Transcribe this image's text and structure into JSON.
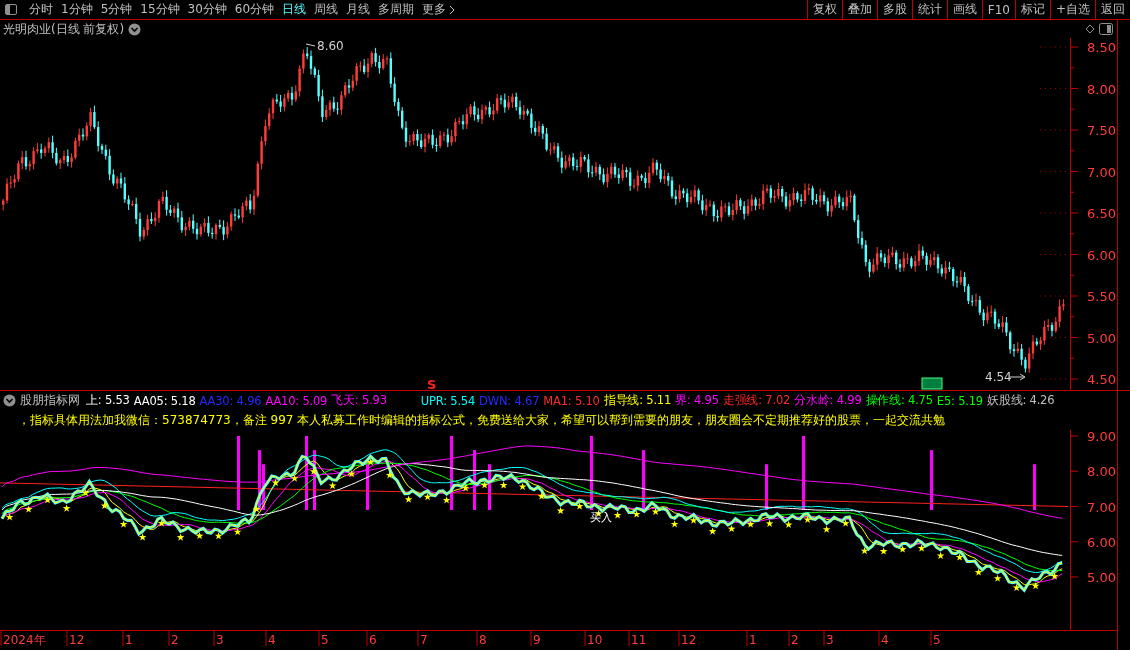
{
  "toolbar": {
    "periods": [
      {
        "label": "分时",
        "selected": false
      },
      {
        "label": "1分钟",
        "selected": false
      },
      {
        "label": "5分钟",
        "selected": false
      },
      {
        "label": "15分钟",
        "selected": false
      },
      {
        "label": "30分钟",
        "selected": false
      },
      {
        "label": "60分钟",
        "selected": false
      },
      {
        "label": "日线",
        "selected": true
      },
      {
        "label": "周线",
        "selected": false
      },
      {
        "label": "月线",
        "selected": false
      },
      {
        "label": "多周期",
        "selected": false
      },
      {
        "label": "更多",
        "selected": false
      }
    ],
    "actions": [
      "复权",
      "叠加",
      "多股",
      "统计",
      "画线",
      "F10",
      "标记",
      "+自选",
      "返回"
    ]
  },
  "chart": {
    "title": "光明肉业(日线 前复权)",
    "high_label": "8.60",
    "low_label": "4.54",
    "signal_mark": "S",
    "y_labels": [
      "8.50",
      "8.00",
      "7.50",
      "7.00",
      "6.50",
      "6.00",
      "5.50",
      "5.00",
      "4.50"
    ]
  },
  "indicator": {
    "name": "股朋指标网",
    "values": [
      {
        "text": "上: 5.53",
        "color": "#ffffff"
      },
      {
        "text": "AA05: 5.18",
        "color": "#ffffff"
      },
      {
        "text": "AA30: 4.96",
        "color": "#2828ff"
      },
      {
        "text": "AA10: 5.09",
        "color": "#ff00ff"
      },
      {
        "text": "飞天: 5.93",
        "color": "#ff00ff"
      },
      {
        "text": "UPR: 5.54",
        "color": "#00ffff"
      },
      {
        "text": "DWN: 4.67",
        "color": "#2828ff"
      },
      {
        "text": "MA1: 5.10",
        "color": "#ff2828"
      },
      {
        "text": "指导线: 5.11",
        "color": "#ffff00"
      },
      {
        "text": "界: 4.95",
        "color": "#ff00ff"
      },
      {
        "text": "走强线: 7.02",
        "color": "#ff2828"
      },
      {
        "text": "分水岭: 4.99",
        "color": "#ff00ff"
      },
      {
        "text": "操作线: 4.75",
        "color": "#00ff00"
      },
      {
        "text": "E5: 5.19",
        "color": "#00ff00"
      },
      {
        "text": "妖股线: 4.26",
        "color": "#c0c0c0"
      }
    ],
    "note": "，指标具体用法加我微信：573874773，备注 997 本人私募工作时编辑的指标公式，免费送给大家，希望可以帮到需要的朋友，朋友圈会不定期推荐好的股票，一起交流共勉",
    "buy_label": "买入",
    "y_labels": [
      "9.00",
      "8.00",
      "7.00",
      "6.00",
      "5.00"
    ]
  },
  "x_axis": [
    "2024年",
    "12",
    "1",
    "2",
    "3",
    "4",
    "5",
    "6",
    "7",
    "8",
    "9",
    "10",
    "11",
    "12",
    "1",
    "2",
    "3",
    "4",
    "5"
  ]
}
